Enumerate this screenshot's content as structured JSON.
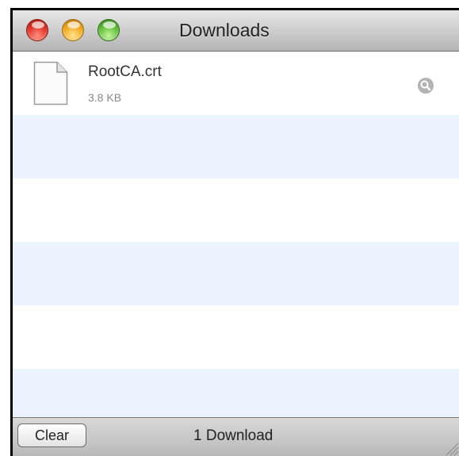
{
  "window": {
    "title": "Downloads"
  },
  "downloads": [
    {
      "name": "RootCA.crt",
      "size": "3.8 KB",
      "icon": "document-icon"
    }
  ],
  "footer": {
    "clear_label": "Clear",
    "status": "1 Download"
  },
  "colors": {
    "stripe": "#edf3fe",
    "titlebar": "#cbcbcb"
  }
}
